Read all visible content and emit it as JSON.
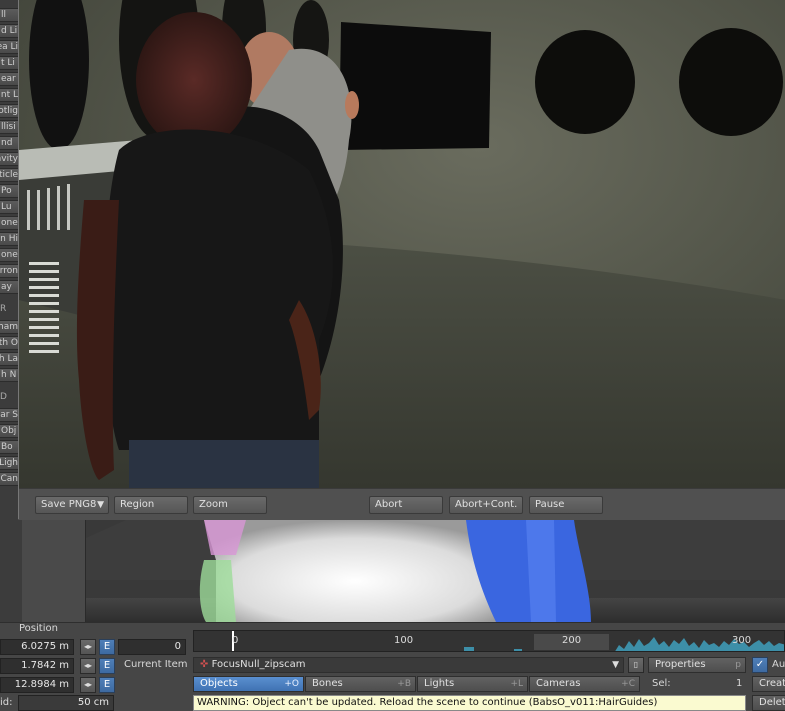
{
  "left_panel": {
    "items": [
      "ll",
      "d Li",
      "ea Li",
      "t Li",
      "ear",
      "nt L",
      "otlig",
      "llisi",
      "nd",
      "avity",
      "ticle",
      "Po",
      "Lu",
      "one",
      "n Hi",
      "one",
      "rron",
      "ay"
    ],
    "section1": "R",
    "items2": [
      "ham",
      "th O",
      "h La",
      "h N"
    ],
    "section2": "D",
    "items3": [
      "ar S",
      "Obj",
      "Bo",
      "Ligh",
      "Can"
    ]
  },
  "render_toolbar": {
    "save_label": "Save PNG8",
    "region_label": "Region",
    "zoom_label": "Zoom",
    "abort_label": "Abort",
    "abort_cont_label": "Abort+Cont.",
    "pause_label": "Pause"
  },
  "bottom": {
    "position_label": "Position",
    "x_value": "6.0275 m",
    "y_value": "1.7842 m",
    "z_value": "12.8984 m",
    "grid_label": "id:",
    "grid_value": "50 cm",
    "e_label": "E",
    "frame_value": "0",
    "current_item_label": "Current Item",
    "current_item_value": "FocusNull_zipscam",
    "properties_label": "Properties",
    "properties_shortcut": "p",
    "auto_label": "Au",
    "create_label": "Creat",
    "delete_label": "Delet",
    "sel_label": "Sel:",
    "sel_value": "1",
    "tabs": [
      {
        "label": "Objects",
        "shortcut": "+O"
      },
      {
        "label": "Bones",
        "shortcut": "+B"
      },
      {
        "label": "Lights",
        "shortcut": "+L"
      },
      {
        "label": "Cameras",
        "shortcut": "+C"
      }
    ],
    "warning_text": "WARNING: Object can't be updated. Reload the scene to continue  (BabsO_v011:HairGuides)"
  },
  "timeline": {
    "labels": [
      "0",
      "100",
      "200",
      "300"
    ],
    "current_frame": 0
  },
  "colors": {
    "accent": "#3f72b2",
    "warning_bg": "#fafad0"
  }
}
